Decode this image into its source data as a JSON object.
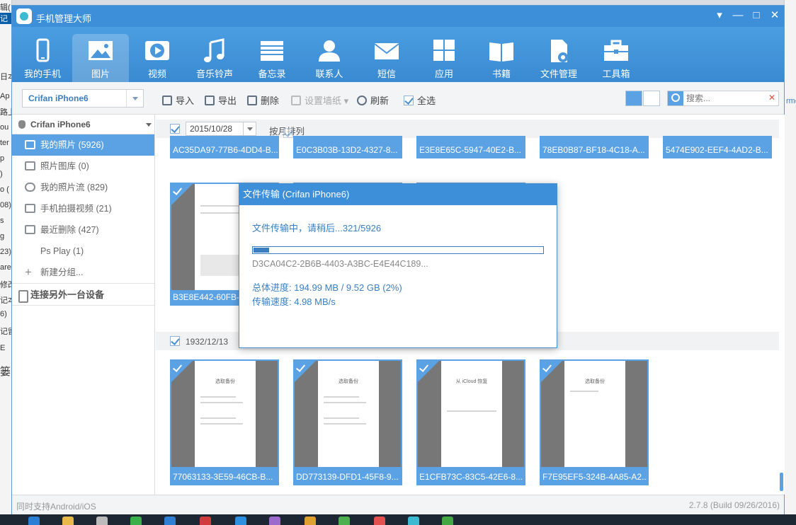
{
  "app": {
    "title": "手机管理大师"
  },
  "window_controls": [
    "▾",
    "—",
    "□",
    "✕"
  ],
  "nav": [
    {
      "label": "我的手机",
      "icon": "phone-icon",
      "active": false
    },
    {
      "label": "图片",
      "icon": "picture-icon",
      "active": true
    },
    {
      "label": "视频",
      "icon": "play-icon",
      "active": false
    },
    {
      "label": "音乐铃声",
      "icon": "music-note-icon",
      "active": false
    },
    {
      "label": "备忘录",
      "icon": "memo-icon",
      "active": false
    },
    {
      "label": "联系人",
      "icon": "contact-icon",
      "active": false
    },
    {
      "label": "短信",
      "icon": "envelope-icon",
      "active": false
    },
    {
      "label": "应用",
      "icon": "apps-grid-icon",
      "active": false
    },
    {
      "label": "书籍",
      "icon": "book-icon",
      "active": false
    },
    {
      "label": "文件管理",
      "icon": "file-gear-icon",
      "active": false
    },
    {
      "label": "工具箱",
      "icon": "toolbox-icon",
      "active": false
    }
  ],
  "toolbar": {
    "device_select": "Crifan iPhone6",
    "import": "导入",
    "export": "导出",
    "delete": "删除",
    "wallpaper": "设置墙纸",
    "refresh": "刷新",
    "select_all": "全选",
    "search_placeholder": "搜索..."
  },
  "sidebar": {
    "device": "Crifan iPhone6",
    "items": [
      {
        "label": "我的照片 (5926)",
        "active": true
      },
      {
        "label": "照片图库 (0)",
        "active": false
      },
      {
        "label": "我的照片流 (829)",
        "active": false
      },
      {
        "label": "手机拍摄视频 (21)",
        "active": false
      },
      {
        "label": "最近删除 (427)",
        "active": false
      },
      {
        "label": "Ps Play (1)",
        "active": false
      }
    ],
    "add_group": "新建分组...",
    "connect": "连接另外一台设备"
  },
  "groups": [
    {
      "date": "2015/10/28",
      "month_sort": "按月排列",
      "row1": [
        "AC35DA97-77B6-4DD4-B...",
        "E0C3B03B-13D2-4327-8...",
        "E3E8E65C-5947-40E2-B...",
        "78EB0B87-BF18-4C18-A...",
        "5474E902-EEF4-4AD2-B..."
      ],
      "row2": [
        "B3E8E442-60FB-"
      ]
    },
    {
      "date": "1932/12/13",
      "photos": [
        {
          "name": "77063133-3E59-46CB-B...",
          "heading": "选取备份"
        },
        {
          "name": "DD773139-DFD1-45F8-9...",
          "heading": "选取备份"
        },
        {
          "name": "E1CFB73C-83C5-42E6-8...",
          "heading": "从 iCloud 恢复"
        },
        {
          "name": "F7E95EF5-324B-4A85-A2...",
          "heading": "选取备份"
        }
      ]
    }
  ],
  "dialog": {
    "title": "文件传输 (Crifan iPhone6)",
    "message": "文件传输中，请稍后...321/5926",
    "progress": 0.054,
    "current_file": "D3CA04C2-2B6B-4403-A3BC-E4E44C189...",
    "total_progress": "总体进度: 194.99 MB / 9.52 GB (2%)",
    "speed": "传输速度: 4.98 MB/s"
  },
  "status": {
    "left": "同时支持Android/iOS",
    "right": "2.7.8 (Build 09/26/2016)"
  },
  "background": {
    "left_fragments": [
      "辑(",
      "记",
      "日本",
      "Ap",
      "路上",
      "ou",
      "ter",
      "p",
      ")",
      "o (",
      "08)",
      "s",
      "g",
      "23)",
      "are",
      "修改",
      "记本",
      "6)",
      "记留",
      "E",
      "篓"
    ],
    "right_fragment": "rmo"
  },
  "colors": {
    "accent": "#3d8fd9",
    "selected": "#5ba2e4"
  }
}
